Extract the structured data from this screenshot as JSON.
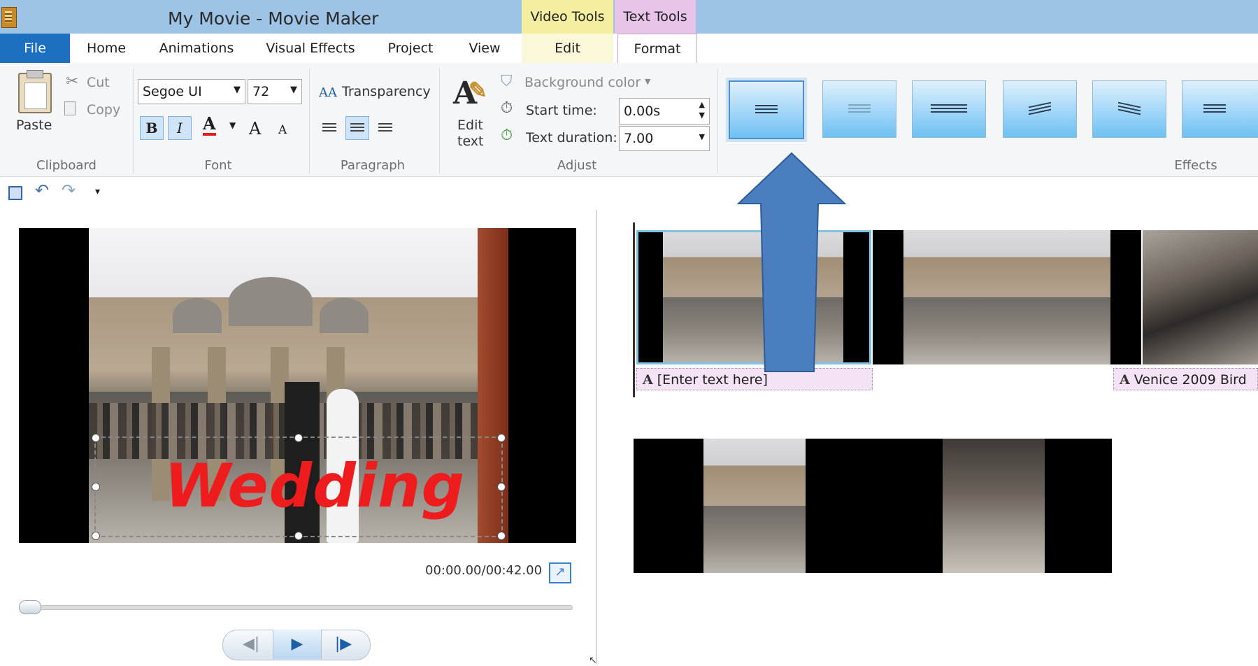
{
  "window": {
    "title": "My Movie - Movie Maker"
  },
  "context_groups": {
    "video_tools": "Video Tools",
    "text_tools": "Text Tools"
  },
  "tabs": {
    "file": "File",
    "home": "Home",
    "animations": "Animations",
    "visual_effects": "Visual Effects",
    "project": "Project",
    "view": "View",
    "edit": "Edit",
    "format": "Format"
  },
  "clipboard": {
    "paste": "Paste",
    "cut": "Cut",
    "copy": "Copy",
    "group": "Clipboard"
  },
  "font": {
    "family": "Segoe UI",
    "size": "72",
    "bold": "B",
    "italic": "I",
    "color_glyph": "A",
    "grow": "A",
    "shrink": "A",
    "group": "Font"
  },
  "paragraph": {
    "transparency": "Transparency",
    "group": "Paragraph"
  },
  "adjust": {
    "edit_text_line1": "Edit",
    "edit_text_line2": "text",
    "background_color": "Background color",
    "start_time_label": "Start time:",
    "start_time_value": "0.00s",
    "text_duration_label": "Text duration:",
    "text_duration_value": "7.00",
    "group": "Adjust"
  },
  "effects": {
    "group": "Effects"
  },
  "preview": {
    "caption": "Wedding",
    "timecode": "00:00.00/00:42.00"
  },
  "timeline": {
    "caption1": "[Enter text here]",
    "caption2": "Venice 2009 Bird"
  },
  "colors": {
    "accent": "#1d6fc0",
    "caption": "#ee1c1c",
    "text_tools": "#e8c4ea",
    "video_tools": "#f3eea0",
    "arrow": "#4a7ebf"
  }
}
